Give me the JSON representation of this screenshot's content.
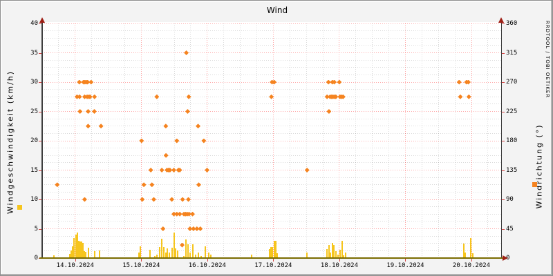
{
  "title": "Wind",
  "watermark": "RRDTOOL / TOBI OETIKER",
  "left_axis": {
    "label": "Windgeschwindigkeit (km/h)",
    "min": 0,
    "max": 40,
    "major_step": 5,
    "minor_step": 1.25,
    "ticks": [
      0,
      5,
      10,
      15,
      20,
      25,
      30,
      35,
      40
    ]
  },
  "right_axis": {
    "label": "Windrichtung (°)",
    "min": 0,
    "max": 360,
    "major_step": 45,
    "ticks": [
      0,
      45,
      90,
      135,
      180,
      225,
      270,
      315,
      360
    ]
  },
  "x_axis": {
    "day_start": 13.5,
    "day_end": 20.45,
    "minor_step_days": 0.25,
    "labels": [
      {
        "day": 14,
        "text": "14.10.2024"
      },
      {
        "day": 15,
        "text": "15.10.2024"
      },
      {
        "day": 16,
        "text": "16.10.2024"
      },
      {
        "day": 17,
        "text": "17.10.2024"
      },
      {
        "day": 18,
        "text": "18.10.2024"
      },
      {
        "day": 19,
        "text": "19.10.2024"
      },
      {
        "day": 20,
        "text": "20.10.2024"
      }
    ]
  },
  "colors": {
    "background": "#f3f3f3",
    "plot_bg": "#ffffff",
    "major_grid": "rgba(255,0,0,0.35)",
    "minor_grid": "rgba(120,120,120,0.28)",
    "axis": "#3f3f3f",
    "baseline": "#7a6b00",
    "arrow": "#9e1f14",
    "tick": "#d24040",
    "bar": "#f6c51d",
    "point": "#f5831f",
    "watermark": "#cfcfcf"
  },
  "chart_data": {
    "type": "mixed",
    "x_unit": "day of October 2024 (fractional = time of day)",
    "series": [
      {
        "name": "Windgeschwindigkeit",
        "type": "bar",
        "axis": "left",
        "unit": "km/h",
        "points": [
          [
            13.675,
            0.5
          ],
          [
            13.916,
            0.7
          ],
          [
            13.937,
            1.3
          ],
          [
            13.958,
            2.0
          ],
          [
            13.986,
            3.4
          ],
          [
            14.01,
            4.0
          ],
          [
            14.031,
            4.3
          ],
          [
            14.052,
            3.0
          ],
          [
            14.073,
            2.8
          ],
          [
            14.094,
            2.8
          ],
          [
            14.115,
            2.6
          ],
          [
            14.136,
            1.2
          ],
          [
            14.157,
            1.1
          ],
          [
            14.199,
            1.8
          ],
          [
            14.293,
            1.2
          ],
          [
            14.366,
            1.3
          ],
          [
            14.963,
            1.0
          ],
          [
            14.984,
            2.0
          ],
          [
            15.131,
            1.4
          ],
          [
            15.204,
            0.4
          ],
          [
            15.236,
            0.6
          ],
          [
            15.277,
            1.9
          ],
          [
            15.309,
            3.3
          ],
          [
            15.34,
            1.9
          ],
          [
            15.372,
            1.0
          ],
          [
            15.393,
            1.6
          ],
          [
            15.424,
            1.0
          ],
          [
            15.466,
            1.8
          ],
          [
            15.497,
            4.4
          ],
          [
            15.518,
            1.6
          ],
          [
            15.55,
            1.25
          ],
          [
            15.644,
            0.4
          ],
          [
            15.675,
            3.2
          ],
          [
            15.707,
            2.3
          ],
          [
            15.738,
            1.0
          ],
          [
            15.78,
            2.4
          ],
          [
            15.822,
            0.6
          ],
          [
            15.864,
            1.0
          ],
          [
            15.906,
            0.4
          ],
          [
            15.969,
            2.0
          ],
          [
            16.021,
            1.0
          ],
          [
            16.052,
            0.6
          ],
          [
            16.67,
            0.6
          ],
          [
            16.942,
            1.5
          ],
          [
            16.963,
            1.9
          ],
          [
            16.984,
            1.9
          ],
          [
            17.016,
            3.0
          ],
          [
            17.037,
            3.0
          ],
          [
            17.058,
            0.8
          ],
          [
            17.508,
            1.0
          ],
          [
            17.812,
            1.5
          ],
          [
            17.843,
            2.2
          ],
          [
            17.864,
            1.0
          ],
          [
            17.895,
            2.6
          ],
          [
            17.916,
            2.2
          ],
          [
            17.948,
            1.2
          ],
          [
            17.979,
            0.6
          ],
          [
            18.01,
            1.4
          ],
          [
            18.042,
            2.9
          ],
          [
            18.063,
            0.5
          ],
          [
            18.094,
            1.0
          ],
          [
            19.884,
            2.5
          ],
          [
            19.905,
            1.0
          ],
          [
            19.988,
            3.4
          ],
          [
            20.02,
            0.8
          ]
        ]
      },
      {
        "name": "Windrichtung",
        "type": "scatter",
        "axis": "right",
        "unit": "°",
        "marker": "diamond",
        "points": [
          [
            13.728,
            112.5
          ],
          [
            14.028,
            247.5
          ],
          [
            14.063,
            270
          ],
          [
            14.066,
            247.5
          ],
          [
            14.073,
            225
          ],
          [
            14.126,
            270
          ],
          [
            14.143,
            247.5
          ],
          [
            14.143,
            90
          ],
          [
            14.147,
            270
          ],
          [
            14.168,
            270
          ],
          [
            14.181,
            247.5
          ],
          [
            14.188,
            270
          ],
          [
            14.196,
            225
          ],
          [
            14.196,
            202.5
          ],
          [
            14.209,
            247.5
          ],
          [
            14.225,
            247.5
          ],
          [
            14.241,
            270
          ],
          [
            14.29,
            225
          ],
          [
            14.293,
            247.5
          ],
          [
            14.391,
            202.5
          ],
          [
            15.005,
            180
          ],
          [
            15.016,
            90
          ],
          [
            15.04,
            112.5
          ],
          [
            15.145,
            135
          ],
          [
            15.162,
            112.5
          ],
          [
            15.19,
            90
          ],
          [
            15.236,
            247.5
          ],
          [
            15.312,
            135
          ],
          [
            15.33,
            45
          ],
          [
            15.372,
            202.5
          ],
          [
            15.375,
            157.5
          ],
          [
            15.39,
            135
          ],
          [
            15.414,
            135
          ],
          [
            15.435,
            135
          ],
          [
            15.463,
            90
          ],
          [
            15.494,
            135
          ],
          [
            15.494,
            67.5
          ],
          [
            15.539,
            180
          ],
          [
            15.539,
            67.5
          ],
          [
            15.563,
            135
          ],
          [
            15.584,
            135
          ],
          [
            15.584,
            67.5
          ],
          [
            15.62,
            20
          ],
          [
            15.626,
            90
          ],
          [
            15.647,
            67.5
          ],
          [
            15.672,
            67.5
          ],
          [
            15.683,
            315
          ],
          [
            15.696,
            67.5
          ],
          [
            15.703,
            225
          ],
          [
            15.714,
            90
          ],
          [
            15.72,
            247.5
          ],
          [
            15.724,
            67.5
          ],
          [
            15.738,
            45
          ],
          [
            15.777,
            67.5
          ],
          [
            15.791,
            45
          ],
          [
            15.843,
            45
          ],
          [
            15.861,
            202.5
          ],
          [
            15.871,
            112.5
          ],
          [
            15.895,
            45
          ],
          [
            15.948,
            180
          ],
          [
            15.997,
            135
          ],
          [
            16.971,
            247.5
          ],
          [
            16.981,
            270
          ],
          [
            17.013,
            270
          ],
          [
            17.511,
            135
          ],
          [
            17.814,
            247.5
          ],
          [
            17.835,
            270
          ],
          [
            17.843,
            225
          ],
          [
            17.86,
            247.5
          ],
          [
            17.884,
            247.5
          ],
          [
            17.895,
            270
          ],
          [
            17.905,
            247.5
          ],
          [
            17.923,
            270
          ],
          [
            17.929,
            247.5
          ],
          [
            17.947,
            247.5
          ],
          [
            18.0,
            270
          ],
          [
            18.01,
            247.5
          ],
          [
            18.036,
            247.5
          ],
          [
            18.057,
            247.5
          ],
          [
            19.814,
            270
          ],
          [
            19.832,
            247.5
          ],
          [
            19.926,
            270
          ],
          [
            19.953,
            270
          ],
          [
            19.961,
            247.5
          ]
        ]
      }
    ]
  }
}
